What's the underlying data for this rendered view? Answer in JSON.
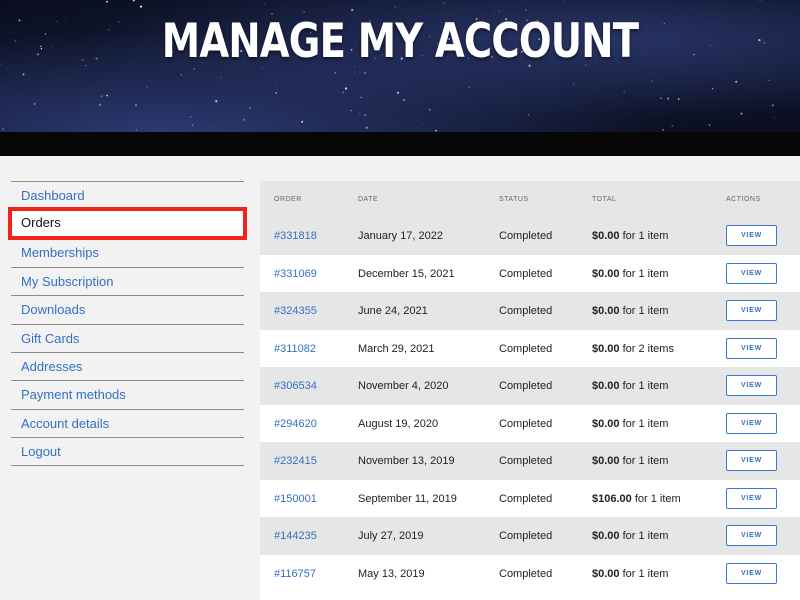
{
  "header": {
    "title": "MANAGE MY ACCOUNT"
  },
  "sidebar": {
    "items": [
      {
        "label": "Dashboard",
        "active": false
      },
      {
        "label": "Orders",
        "active": true
      },
      {
        "label": "Memberships",
        "active": false
      },
      {
        "label": "My Subscription",
        "active": false
      },
      {
        "label": "Downloads",
        "active": false
      },
      {
        "label": "Gift Cards",
        "active": false
      },
      {
        "label": "Addresses",
        "active": false
      },
      {
        "label": "Payment methods",
        "active": false
      },
      {
        "label": "Account details",
        "active": false
      },
      {
        "label": "Logout",
        "active": false
      }
    ]
  },
  "orders": {
    "columns": {
      "order": "ORDER",
      "date": "DATE",
      "status": "STATUS",
      "total": "TOTAL",
      "actions": "ACTIONS"
    },
    "view_label": "VIEW",
    "rows": [
      {
        "order": "#331818",
        "date": "January 17, 2022",
        "status": "Completed",
        "amount": "$0.00",
        "items": "for 1 item"
      },
      {
        "order": "#331069",
        "date": "December 15, 2021",
        "status": "Completed",
        "amount": "$0.00",
        "items": "for 1 item"
      },
      {
        "order": "#324355",
        "date": "June 24, 2021",
        "status": "Completed",
        "amount": "$0.00",
        "items": "for 1 item"
      },
      {
        "order": "#311082",
        "date": "March 29, 2021",
        "status": "Completed",
        "amount": "$0.00",
        "items": "for 2 items"
      },
      {
        "order": "#306534",
        "date": "November 4, 2020",
        "status": "Completed",
        "amount": "$0.00",
        "items": "for 1 item"
      },
      {
        "order": "#294620",
        "date": "August 19, 2020",
        "status": "Completed",
        "amount": "$0.00",
        "items": "for 1 item"
      },
      {
        "order": "#232415",
        "date": "November 13, 2019",
        "status": "Completed",
        "amount": "$0.00",
        "items": "for 1 item"
      },
      {
        "order": "#150001",
        "date": "September 11, 2019",
        "status": "Completed",
        "amount": "$106.00",
        "items": "for 1 item"
      },
      {
        "order": "#144235",
        "date": "July 27, 2019",
        "status": "Completed",
        "amount": "$0.00",
        "items": "for 1 item"
      },
      {
        "order": "#116757",
        "date": "May 13, 2019",
        "status": "Completed",
        "amount": "$0.00",
        "items": "for 1 item"
      }
    ]
  },
  "colors": {
    "link": "#3470c4",
    "highlight_border": "#f0241b",
    "row_alt": "#e6e6e6",
    "header_bg": "#0a0e1f"
  }
}
